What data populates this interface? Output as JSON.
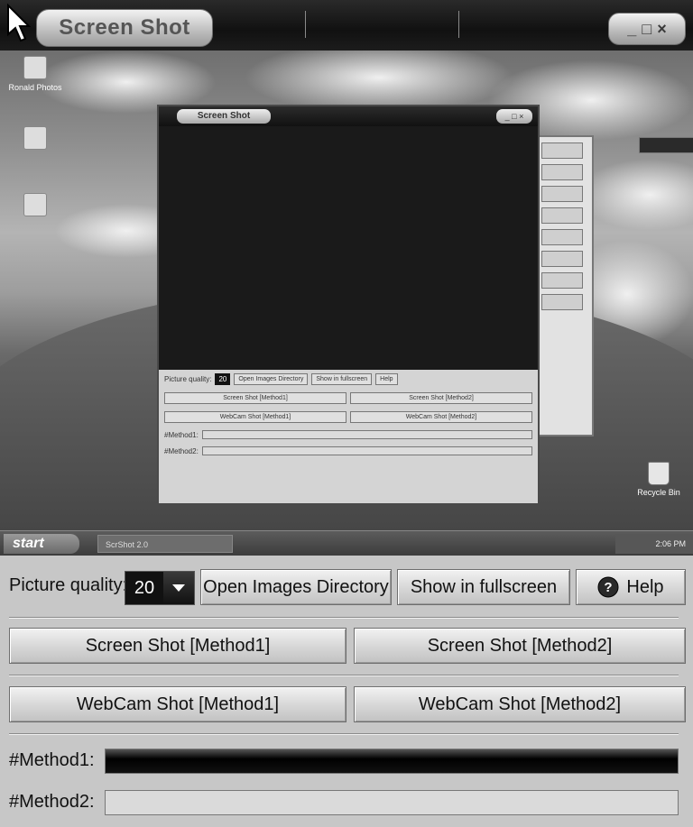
{
  "window": {
    "title": "Screen Shot",
    "controls": [
      "_",
      "□",
      "×"
    ]
  },
  "preview": {
    "desktop_icons": [
      {
        "label": "Ronald Photos"
      },
      {
        "label": "Recycle Bin"
      }
    ],
    "taskbar": {
      "start_label": "start",
      "task_label": "ScrShot 2.0",
      "clock": "2:06 PM"
    },
    "mini_window": {
      "title": "Screen Shot",
      "picture_quality_label": "Picture quality:",
      "picture_quality_value": "20",
      "open_images_label": "Open Images Directory",
      "fullscreen_label": "Show in fullscreen",
      "help_label": "Help",
      "screen_shot_m1": "Screen Shot [Method1]",
      "screen_shot_m2": "Screen Shot [Method2]",
      "webcam_m1": "WebCam Shot [Method1]",
      "webcam_m2": "WebCam Shot [Method2]",
      "method1_label": "#Method1:",
      "method2_label": "#Method2:"
    }
  },
  "controls": {
    "picture_quality_label": "Picture quality:",
    "picture_quality_value": "20",
    "open_images_label": "Open Images Directory",
    "fullscreen_label": "Show in fullscreen",
    "help_label": "Help"
  },
  "actions": {
    "screen_shot_m1": "Screen Shot [Method1]",
    "screen_shot_m2": "Screen Shot [Method2]",
    "webcam_m1": "WebCam Shot [Method1]",
    "webcam_m2": "WebCam Shot [Method2]"
  },
  "progress": {
    "method1_label": "#Method1:",
    "method1_fill": 1.0,
    "method2_label": "#Method2:",
    "method2_fill": 0.0
  },
  "colors": {
    "titlebar": "#111111",
    "panel": "#c7c7c7",
    "quality_box": "#111111"
  }
}
